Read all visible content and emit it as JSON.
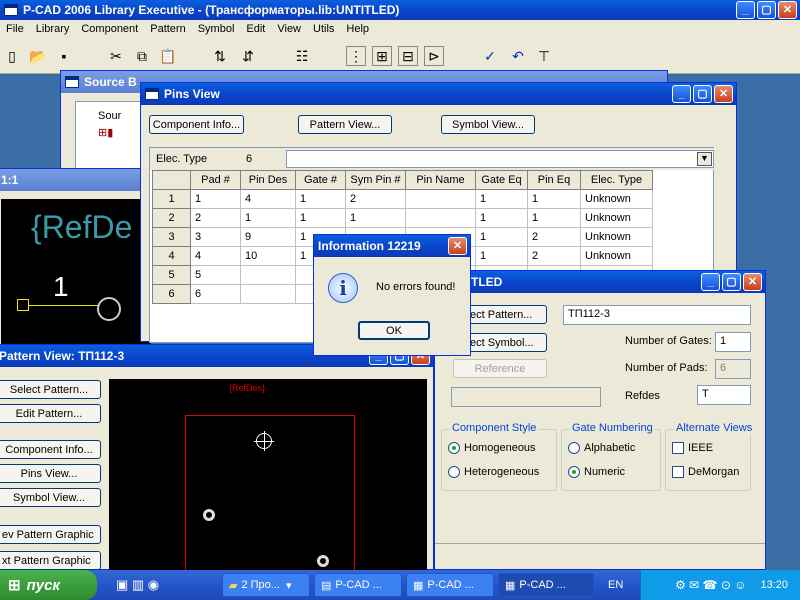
{
  "main_window": {
    "title": "P-CAD 2006 Library Executive - (Трансформаторы.lib:UNTITLED)",
    "menu": [
      "File",
      "Library",
      "Component",
      "Pattern",
      "Symbol",
      "Edit",
      "View",
      "Utils",
      "Help"
    ]
  },
  "source_browser": {
    "title": "Source B",
    "tree_item": "Sour"
  },
  "symbol_view": {
    "title": "1:1",
    "refdes": "{RefDe",
    "pin_number": "1"
  },
  "pins_view": {
    "title": "Pins View",
    "buttons": [
      "Component Info...",
      "Pattern View...",
      "Symbol View..."
    ],
    "elec_type_label": "Elec. Type",
    "elec_type_value": "6",
    "columns": [
      "",
      "Pad #",
      "Pin Des",
      "Gate #",
      "Sym Pin #",
      "Pin Name",
      "Gate Eq",
      "Pin Eq",
      "Elec. Type"
    ],
    "rows": [
      [
        "1",
        "1",
        "4",
        "1",
        "2",
        "",
        "1",
        "1",
        "Unknown"
      ],
      [
        "2",
        "2",
        "1",
        "1",
        "1",
        "",
        "1",
        "1",
        "Unknown"
      ],
      [
        "3",
        "3",
        "9",
        "1",
        "",
        "",
        "1",
        "2",
        "Unknown"
      ],
      [
        "4",
        "4",
        "10",
        "1",
        "",
        "",
        "1",
        "2",
        "Unknown"
      ],
      [
        "5",
        "5",
        "",
        "",
        "",
        "",
        "",
        "",
        ""
      ],
      [
        "6",
        "6",
        "",
        "",
        "",
        "",
        "",
        "",
        ""
      ]
    ]
  },
  "info_dialog": {
    "title": "Information  12219",
    "message": "No errors found!",
    "ok_label": "OK"
  },
  "component_window": {
    "title": ":UNTITLED",
    "select_pattern": "ect Pattern...",
    "select_symbol": "ect Symbol...",
    "reference": "Reference",
    "pattern_name": "ТП112-3",
    "gates_label": "Number of Gates:",
    "gates_value": "1",
    "pads_label": "Number of Pads:",
    "pads_value": "6",
    "refdes_label": "Refdes",
    "refdes_value": "T",
    "style_group": "Component Style",
    "style_options": [
      "Homogeneous",
      "Heterogeneous"
    ],
    "gate_group": "Gate Numbering",
    "gate_options": [
      "Alphabetic",
      "Numeric"
    ],
    "alt_group": "Alternate Views",
    "alt_options": [
      "IEEE",
      "DeMorgan"
    ]
  },
  "pattern_view": {
    "title": "Pattern View: ТП112-3",
    "buttons": [
      "Select Pattern...",
      "Edit Pattern...",
      "Component Info...",
      "Pins View...",
      "Symbol View...",
      "ev Pattern Graphic",
      "xt Pattern Graphic"
    ],
    "refdes": "{RefDes}"
  },
  "taskbar": {
    "start": "пуск",
    "items": [
      "2 Про...",
      "P-CAD ...",
      "P-CAD ...",
      "P-CAD ..."
    ],
    "lang": "EN",
    "clock": "13:20"
  },
  "colors": {
    "titlebar": "#0a42c8",
    "desktop": "#3a6ea5",
    "dialog": "#ece9d8"
  }
}
